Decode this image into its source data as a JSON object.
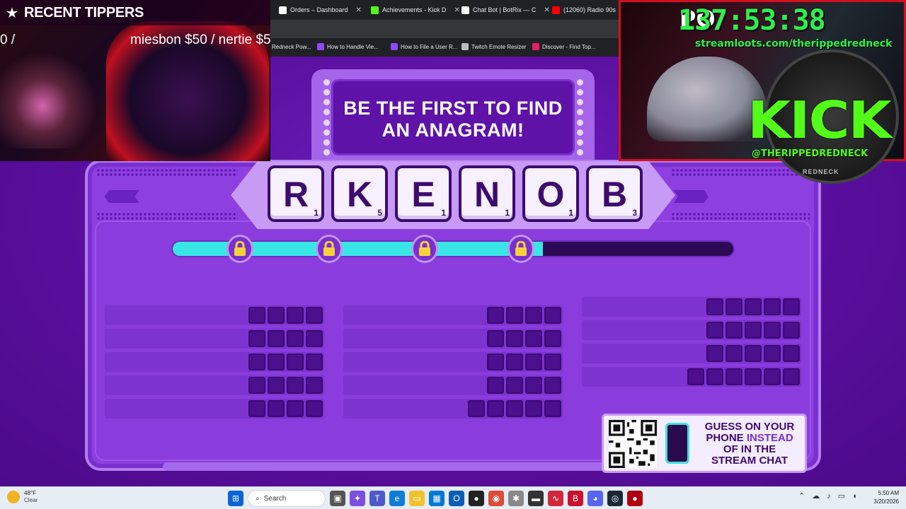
{
  "game": {
    "title": "BE THE FIRST TO FIND AN ANAGRAM!",
    "tiles": [
      {
        "letter": "R",
        "points": "1"
      },
      {
        "letter": "K",
        "points": "5"
      },
      {
        "letter": "E",
        "points": "1"
      },
      {
        "letter": "N",
        "points": "1"
      },
      {
        "letter": "O",
        "points": "1"
      },
      {
        "letter": "B",
        "points": "3"
      }
    ],
    "progress_fraction": 0.66,
    "lock_count": 4,
    "answer_columns": [
      {
        "rows": [
          4,
          4,
          4,
          4,
          4
        ]
      },
      {
        "rows": [
          4,
          4,
          4,
          4,
          5
        ]
      },
      {
        "rows": [
          5,
          5,
          5,
          6
        ]
      }
    ],
    "qr_panel": {
      "line1": "GUESS ON YOUR",
      "line2a": "PHONE ",
      "line2b": "INSTEAD",
      "line3": "OF IN THE",
      "line4": "STREAM CHAT"
    }
  },
  "overlay": {
    "recent_tippers_title": "RECENT TIPPERS",
    "tipper_a": "0 /",
    "tipper_b": "miesbon $50 / nertie $50",
    "timer_prefix": "PO",
    "timer": "137:53:38",
    "streamloots_url": "streamloots.com/therippedredneck",
    "kick_logo": "KICK",
    "kick_handle": "@THERIPPEDREDNECK",
    "redneck_label": "REDNECK"
  },
  "browser": {
    "tabs": [
      {
        "label": "Orders – Dashboard",
        "color": "#ffffff"
      },
      {
        "label": "Achievements - Kick D",
        "color": "#53fc18"
      },
      {
        "label": "Chat Bot | BotRix — C",
        "color": "#ffffff"
      },
      {
        "label": "(12060) Radio 90s",
        "color": "#ff0000"
      }
    ],
    "bookmarks": [
      {
        "label": "Redneck Pow...",
        "color": "#ffffff"
      },
      {
        "label": "How to Handle Vie...",
        "color": "#9146ff"
      },
      {
        "label": "How to File a User R...",
        "color": "#9146ff"
      },
      {
        "label": "Twitch Emote Resizer",
        "color": "#bbbbbb"
      },
      {
        "label": "Discover - Find Top...",
        "color": "#e91e63"
      }
    ]
  },
  "taskbar": {
    "temp": "48°F",
    "condition": "Clear",
    "search_placeholder": "Search",
    "time": "5:50 AM",
    "date": "3/20/2026"
  },
  "colors": {
    "board_bg": "#5a0f9e",
    "panel": "#8e3fe0",
    "progress_fill": "#39e6e6",
    "kick_green": "#53fc18",
    "timer_green": "#2ef04a"
  }
}
